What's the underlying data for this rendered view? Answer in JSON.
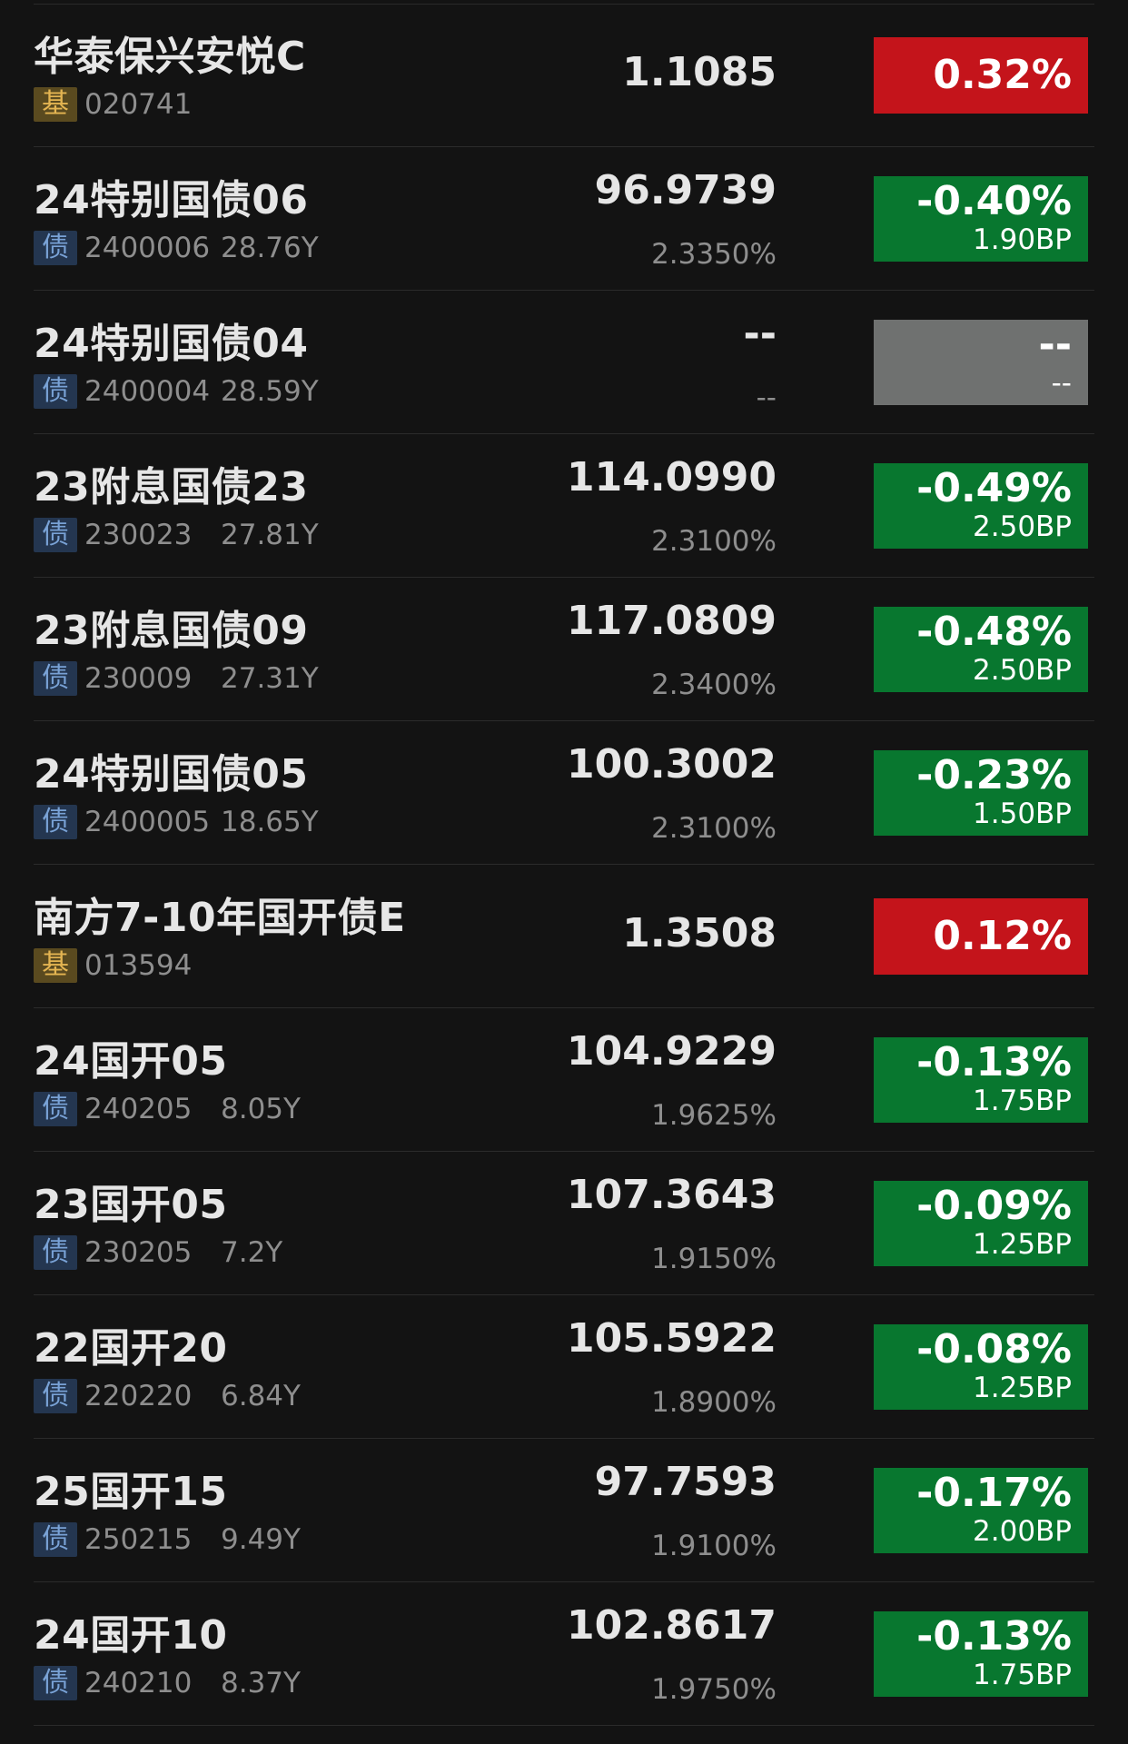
{
  "rows": [
    {
      "name": "华泰保兴安悦C",
      "tag": "基",
      "type": "fund",
      "code": "020741",
      "tenor": "",
      "price": "1.1085",
      "yield": "",
      "change_pct": "0.32%",
      "change_bp": "",
      "direction": "up"
    },
    {
      "name": "24特别国债06",
      "tag": "债",
      "type": "bond",
      "code": "2400006",
      "tenor": "28.76Y",
      "price": "96.9739",
      "yield": "2.3350%",
      "change_pct": "-0.40%",
      "change_bp": "1.90BP",
      "direction": "down"
    },
    {
      "name": "24特别国债04",
      "tag": "债",
      "type": "bond",
      "code": "2400004",
      "tenor": "28.59Y",
      "price": "--",
      "yield": "--",
      "change_pct": "--",
      "change_bp": "--",
      "direction": "flat"
    },
    {
      "name": "23附息国债23",
      "tag": "债",
      "type": "bond",
      "code": "230023",
      "tenor": "27.81Y",
      "price": "114.0990",
      "yield": "2.3100%",
      "change_pct": "-0.49%",
      "change_bp": "2.50BP",
      "direction": "down"
    },
    {
      "name": "23附息国债09",
      "tag": "债",
      "type": "bond",
      "code": "230009",
      "tenor": "27.31Y",
      "price": "117.0809",
      "yield": "2.3400%",
      "change_pct": "-0.48%",
      "change_bp": "2.50BP",
      "direction": "down"
    },
    {
      "name": "24特别国债05",
      "tag": "债",
      "type": "bond",
      "code": "2400005",
      "tenor": "18.65Y",
      "price": "100.3002",
      "yield": "2.3100%",
      "change_pct": "-0.23%",
      "change_bp": "1.50BP",
      "direction": "down"
    },
    {
      "name": "南方7-10年国开债E",
      "tag": "基",
      "type": "fund",
      "code": "013594",
      "tenor": "",
      "price": "1.3508",
      "yield": "",
      "change_pct": "0.12%",
      "change_bp": "",
      "direction": "up"
    },
    {
      "name": "24国开05",
      "tag": "债",
      "type": "bond",
      "code": "240205",
      "tenor": "8.05Y",
      "price": "104.9229",
      "yield": "1.9625%",
      "change_pct": "-0.13%",
      "change_bp": "1.75BP",
      "direction": "down"
    },
    {
      "name": "23国开05",
      "tag": "债",
      "type": "bond",
      "code": "230205",
      "tenor": "7.2Y",
      "price": "107.3643",
      "yield": "1.9150%",
      "change_pct": "-0.09%",
      "change_bp": "1.25BP",
      "direction": "down"
    },
    {
      "name": "22国开20",
      "tag": "债",
      "type": "bond",
      "code": "220220",
      "tenor": "6.84Y",
      "price": "105.5922",
      "yield": "1.8900%",
      "change_pct": "-0.08%",
      "change_bp": "1.25BP",
      "direction": "down"
    },
    {
      "name": "25国开15",
      "tag": "债",
      "type": "bond",
      "code": "250215",
      "tenor": "9.49Y",
      "price": "97.7593",
      "yield": "1.9100%",
      "change_pct": "-0.17%",
      "change_bp": "2.00BP",
      "direction": "down"
    },
    {
      "name": "24国开10",
      "tag": "债",
      "type": "bond",
      "code": "240210",
      "tenor": "8.37Y",
      "price": "102.8617",
      "yield": "1.9750%",
      "change_pct": "-0.13%",
      "change_bp": "1.75BP",
      "direction": "down"
    }
  ],
  "colors": {
    "background": "#131313",
    "up": "#c4141b",
    "down": "#08772f",
    "flat": "#6f7170",
    "fund_tag_bg": "#5a4a1f",
    "fund_tag_text": "#e4b552",
    "bond_tag_bg": "#243650",
    "bond_tag_text": "#79a2d6"
  }
}
